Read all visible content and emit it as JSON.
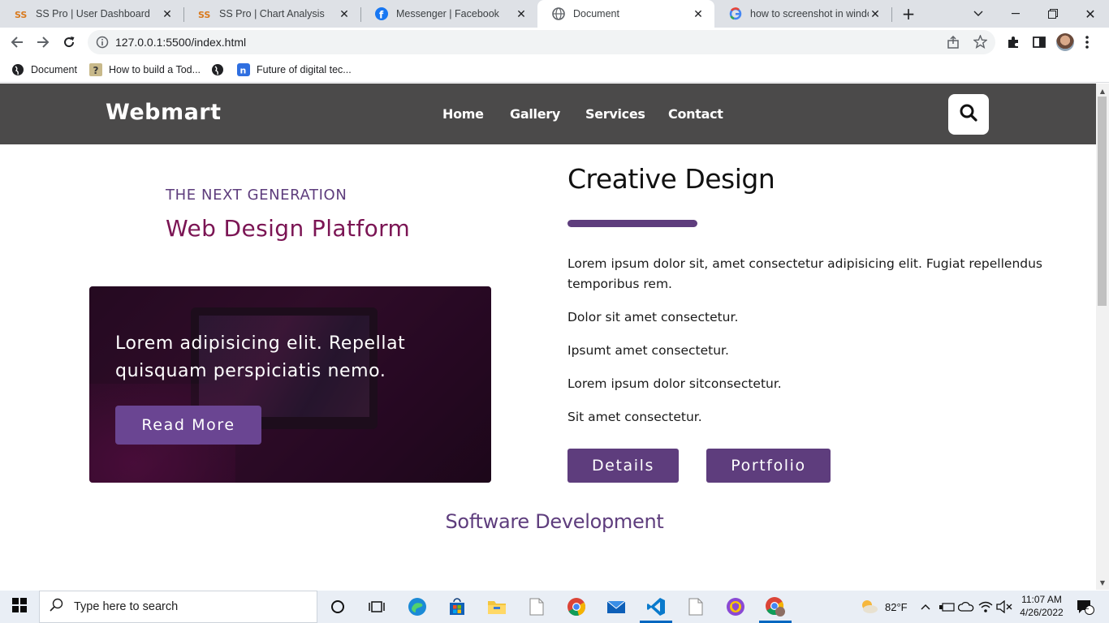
{
  "browser": {
    "tabs": [
      {
        "title": "SS Pro | User Dashboard",
        "icon": "ss-logo-icon",
        "active": false
      },
      {
        "title": "SS Pro | Chart Analysis",
        "icon": "ss-logo-icon",
        "active": false
      },
      {
        "title": "Messenger | Facebook",
        "icon": "facebook-icon",
        "active": false
      },
      {
        "title": "Document",
        "icon": "globe-icon",
        "active": true
      },
      {
        "title": "how to screenshot in windo",
        "icon": "google-icon",
        "active": false
      }
    ],
    "url": "127.0.0.1:5500/index.html",
    "bookmarks": [
      {
        "label": "Document",
        "icon": "globe-icon"
      },
      {
        "label": "How to build a Tod...",
        "icon": "question-icon"
      },
      {
        "label": "",
        "icon": "globe-icon"
      },
      {
        "label": "Future of digital tec...",
        "icon": "n-logo-icon"
      }
    ]
  },
  "site": {
    "logo": "Webmart",
    "nav": [
      "Home",
      "Gallery",
      "Services",
      "Contact"
    ],
    "hero": {
      "eyebrow": "THE NEXT GENERATION",
      "title": "Web Design Platform",
      "card_text": "Lorem adipisicing elit. Repellat quisquam perspiciatis nemo.",
      "button": "Read More"
    },
    "right": {
      "title": "Creative Design",
      "paragraphs": [
        "Lorem ipsum dolor sit, amet consectetur adipisicing elit. Fugiat repellendus temporibus rem.",
        "Dolor sit amet consectetur.",
        "Ipsumt amet consectetur.",
        "Lorem ipsum dolor sitconsectetur.",
        "Sit amet consectetur."
      ],
      "buttons": [
        "Details",
        "Portfolio"
      ]
    },
    "section_title": "Software Development",
    "colors": {
      "nav_bg": "#4b4a4a",
      "accent": "#5e3d7d",
      "hero_title": "#7b1554"
    }
  },
  "taskbar": {
    "search_placeholder": "Type here to search",
    "weather": "82°F",
    "time": "11:07 AM",
    "date": "4/26/2022",
    "notifications": "2"
  }
}
